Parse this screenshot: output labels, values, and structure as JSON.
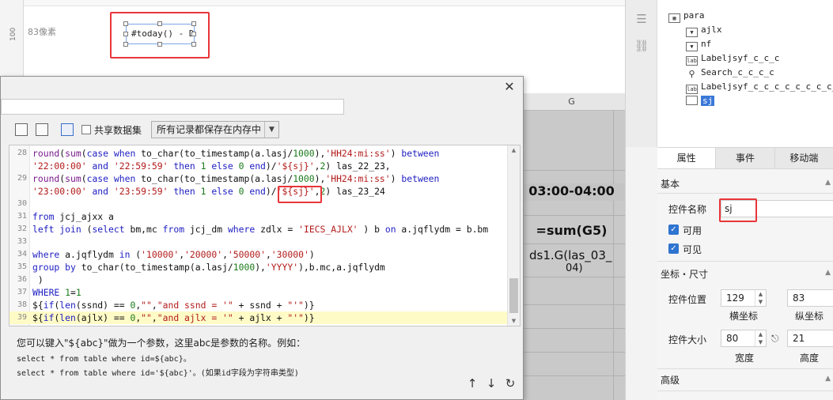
{
  "canvas": {
    "pixel_label": "83像素",
    "ruler_label": "100",
    "widget_text": "#today() - DA"
  },
  "sheet": {
    "column_header": "G",
    "cells": [
      "03:00-04:00",
      "=sum(G5)",
      "ds1.G(las_03_",
      "04)"
    ]
  },
  "dialog": {
    "share_dataset_label": "共享数据集",
    "save_mode_value": "所有记录都保存在内存中",
    "help_line1": "您可以键入\"${abc}\"做为一个参数，这里abc是参数的名称。例如：",
    "help_line2": "select * from table where id=${abc}。",
    "help_line3": "select * from table where id='${abc}'。(如果id字段为字符串类型)",
    "sql_lines": [
      {
        "n": "28",
        "tokens": [
          [
            "fn",
            "round"
          ],
          [
            "pl",
            "("
          ],
          [
            "fn",
            "sum"
          ],
          [
            "pl",
            "("
          ],
          [
            "kw",
            "case when "
          ],
          [
            "pl",
            "to_char(to_timestamp(a.lasj/"
          ],
          [
            "nm",
            "1000"
          ],
          [
            "pl",
            "),"
          ],
          [
            "st",
            "'HH24:mi:ss'"
          ],
          [
            "pl",
            ") "
          ],
          [
            "kw",
            "between"
          ]
        ]
      },
      {
        "n": "",
        "tokens": [
          [
            "st",
            "'22:00:00'"
          ],
          [
            "pl",
            " "
          ],
          [
            "kw",
            "and"
          ],
          [
            "pl",
            " "
          ],
          [
            "st",
            "'22:59:59'"
          ],
          [
            "pl",
            " "
          ],
          [
            "kw",
            "then"
          ],
          [
            "pl",
            " "
          ],
          [
            "nm",
            "1"
          ],
          [
            "pl",
            " "
          ],
          [
            "kw",
            "else"
          ],
          [
            "pl",
            " "
          ],
          [
            "nm",
            "0"
          ],
          [
            "pl",
            " "
          ],
          [
            "kw",
            "end"
          ],
          [
            "pl",
            ")/"
          ],
          [
            "st",
            "'${sj}'"
          ],
          [
            "pl",
            ","
          ],
          [
            "nm",
            "2"
          ],
          [
            "pl",
            ") las_22_23,"
          ]
        ]
      },
      {
        "n": "29",
        "tokens": [
          [
            "fn",
            "round"
          ],
          [
            "pl",
            "("
          ],
          [
            "fn",
            "sum"
          ],
          [
            "pl",
            "("
          ],
          [
            "kw",
            "case when "
          ],
          [
            "pl",
            "to_char(to_timestamp(a.lasj/"
          ],
          [
            "nm",
            "1000"
          ],
          [
            "pl",
            "),"
          ],
          [
            "st",
            "'HH24:mi:ss'"
          ],
          [
            "pl",
            ") "
          ],
          [
            "kw",
            "between"
          ]
        ]
      },
      {
        "n": "",
        "tokens": [
          [
            "st",
            "'23:00:00'"
          ],
          [
            "pl",
            " "
          ],
          [
            "kw",
            "and"
          ],
          [
            "pl",
            " "
          ],
          [
            "st",
            "'23:59:59'"
          ],
          [
            "pl",
            " "
          ],
          [
            "kw",
            "then"
          ],
          [
            "pl",
            " "
          ],
          [
            "nm",
            "1"
          ],
          [
            "pl",
            " "
          ],
          [
            "kw",
            "else"
          ],
          [
            "pl",
            " "
          ],
          [
            "nm",
            "0"
          ],
          [
            "pl",
            " "
          ],
          [
            "kw",
            "end"
          ],
          [
            "pl",
            ")/"
          ],
          [
            "st",
            "'${sj}'"
          ],
          [
            "pl",
            ","
          ],
          [
            "nm",
            "2"
          ],
          [
            "pl",
            ") las_23_24"
          ]
        ]
      },
      {
        "n": "30",
        "tokens": []
      },
      {
        "n": "31",
        "tokens": [
          [
            "kw",
            "from"
          ],
          [
            "pl",
            " jcj_ajxx a"
          ]
        ]
      },
      {
        "n": "32",
        "tokens": [
          [
            "kw",
            "left join"
          ],
          [
            "pl",
            " ("
          ],
          [
            "kw",
            "select"
          ],
          [
            "pl",
            " bm,mc "
          ],
          [
            "kw",
            "from"
          ],
          [
            "pl",
            " jcj_dm "
          ],
          [
            "kw",
            "where"
          ],
          [
            "pl",
            " zdlx = "
          ],
          [
            "st",
            "'IECS_AJLX'"
          ],
          [
            "pl",
            " ) b "
          ],
          [
            "kw",
            "on"
          ],
          [
            "pl",
            " a.jqflydm = b.bm"
          ]
        ]
      },
      {
        "n": "33",
        "tokens": []
      },
      {
        "n": "34",
        "tokens": [
          [
            "kw",
            "where"
          ],
          [
            "pl",
            " a.jqflydm "
          ],
          [
            "kw",
            "in"
          ],
          [
            "pl",
            " ("
          ],
          [
            "st",
            "'10000'"
          ],
          [
            "pl",
            ","
          ],
          [
            "st",
            "'20000'"
          ],
          [
            "pl",
            ","
          ],
          [
            "st",
            "'50000'"
          ],
          [
            "pl",
            ","
          ],
          [
            "st",
            "'30000'"
          ],
          [
            "pl",
            ")"
          ]
        ]
      },
      {
        "n": "35",
        "tokens": [
          [
            "kw",
            "group by"
          ],
          [
            "pl",
            " to_char(to_timestamp(a.lasj/"
          ],
          [
            "nm",
            "1000"
          ],
          [
            "pl",
            "),"
          ],
          [
            "st",
            "'YYYY'"
          ],
          [
            "pl",
            "),b.mc,a.jqflydm"
          ]
        ]
      },
      {
        "n": "36",
        "tokens": [
          [
            "pl",
            " )"
          ]
        ]
      },
      {
        "n": "37",
        "tokens": [
          [
            "kw",
            "WHERE"
          ],
          [
            "pl",
            " "
          ],
          [
            "nm",
            "1"
          ],
          [
            "pl",
            "="
          ],
          [
            "nm",
            "1"
          ]
        ]
      },
      {
        "n": "38",
        "tokens": [
          [
            "pl",
            "${"
          ],
          [
            "kw",
            "if"
          ],
          [
            "pl",
            "("
          ],
          [
            "kw",
            "len"
          ],
          [
            "pl",
            "(ssnd) == "
          ],
          [
            "nm",
            "0"
          ],
          [
            "pl",
            ","
          ],
          [
            "st",
            "\"\""
          ],
          [
            "pl",
            ","
          ],
          [
            "st",
            "\"and ssnd = '\""
          ],
          [
            "pl",
            " + ssnd + "
          ],
          [
            "st",
            "\"'\""
          ],
          [
            "pl",
            ")}"
          ]
        ]
      },
      {
        "n": "39",
        "tokens": [
          [
            "pl",
            "${"
          ],
          [
            "kw",
            "if"
          ],
          [
            "pl",
            "("
          ],
          [
            "kw",
            "len"
          ],
          [
            "pl",
            "(ajlx) == "
          ],
          [
            "nm",
            "0"
          ],
          [
            "pl",
            ","
          ],
          [
            "st",
            "\"\""
          ],
          [
            "pl",
            ","
          ],
          [
            "st",
            "\"and ajlx = '\""
          ],
          [
            "pl",
            " + ajlx + "
          ],
          [
            "st",
            "\"'\""
          ],
          [
            "pl",
            ")}"
          ]
        ]
      }
    ],
    "highlight_line_index": 13
  },
  "tree": {
    "items": [
      {
        "icon": "form-icon",
        "label": "para"
      },
      {
        "icon": "dropdown-icon",
        "label": "ajlx"
      },
      {
        "icon": "dropdown-icon",
        "label": "nf"
      },
      {
        "icon": "label-icon",
        "label": "Labeljsyf_c_c_c"
      },
      {
        "icon": "search-icon",
        "label": "Search_c_c_c_c"
      },
      {
        "icon": "label-icon",
        "label": "Labeljsyf_c_c_c_c_c_c_c_c_c"
      },
      {
        "icon": "textbox-icon",
        "label": "sj"
      }
    ],
    "selected": "sj"
  },
  "props": {
    "tabs": [
      "属性",
      "事件",
      "移动端"
    ],
    "section_basic": "基本",
    "name_label": "控件名称",
    "name_value": "sj",
    "enabled_label": "可用",
    "visible_label": "可见",
    "section_coords": "坐标・尺寸",
    "position_label": "控件位置",
    "pos_x": "129",
    "pos_y": "83",
    "x_caption": "横坐标",
    "y_caption": "纵坐标",
    "size_label": "控件大小",
    "width": "80",
    "height": "21",
    "w_caption": "宽度",
    "h_caption": "高度",
    "section_advanced": "高级"
  },
  "colors": {
    "accent": "#3b78d8",
    "annotation": "#e8363a",
    "line_highlight": "#fffbc6"
  }
}
